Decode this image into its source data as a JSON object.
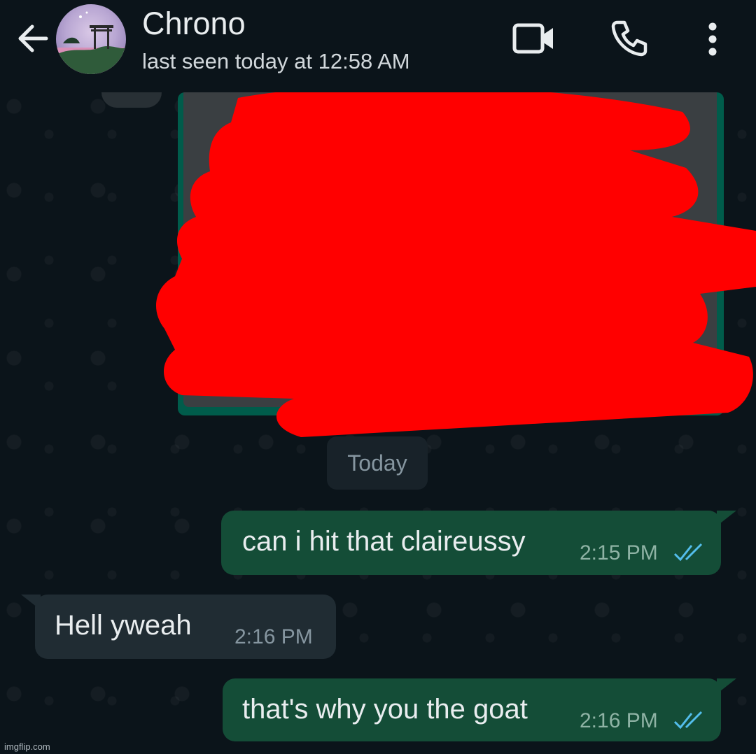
{
  "header": {
    "contact_name": "Chrono",
    "status": "last seen today at 12:58 AM",
    "icons": [
      "back-arrow-icon",
      "avatar",
      "video-call-icon",
      "voice-call-icon",
      "more-options-icon"
    ]
  },
  "chat": {
    "date_divider": "Today",
    "messages": [
      {
        "direction": "outgoing",
        "text": "can i hit that claireussy",
        "time": "2:15 PM",
        "status": "read"
      },
      {
        "direction": "incoming",
        "text": "Hell yweah",
        "time": "2:16 PM"
      },
      {
        "direction": "outgoing",
        "text": "that's why you the goat",
        "time": "2:16 PM",
        "status": "read"
      }
    ]
  },
  "watermark": "imgflip.com",
  "colors": {
    "background": "#0b141a",
    "outgoing_bubble": "#144d37",
    "incoming_bubble": "#202c33",
    "read_ticks": "#53bdeb",
    "redaction": "#ff0000"
  }
}
